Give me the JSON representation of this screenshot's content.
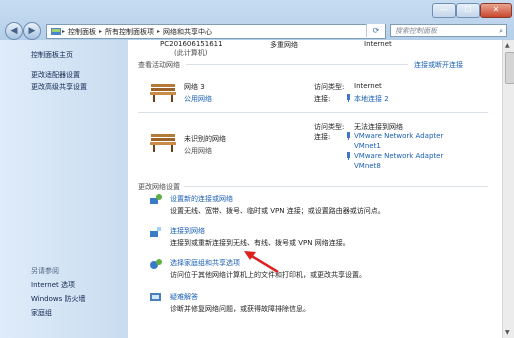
{
  "window": {
    "buttons": {
      "minimize": "—",
      "maximize": "☐",
      "close": "✕"
    }
  },
  "nav": {
    "back": "◀",
    "forward": "▶"
  },
  "breadcrumb": {
    "items": [
      "控制面板",
      "所有控制面板项",
      "网络和共享中心"
    ]
  },
  "search": {
    "placeholder": "搜索控制面板"
  },
  "sidebar": {
    "top_links": [
      "控制面板主页",
      "更改适配器设置",
      "更改高级共享设置"
    ],
    "see_also_title": "另请参阅",
    "see_also": [
      "Internet 选项",
      "Windows 防火墙",
      "家庭组"
    ]
  },
  "top_map": {
    "computer": "PC201606151611",
    "computer_note": "(此计算机)",
    "multi": "多重网络",
    "internet": "Internet"
  },
  "active": {
    "title": "查看活动网络",
    "connect_link": "连接或断开连接",
    "networks": [
      {
        "name": "网络 3",
        "type": "公用网络",
        "access_label": "访问类型:",
        "access_value": "Internet",
        "conn_label": "连接:",
        "conn_values": [
          "本地连接 2"
        ]
      },
      {
        "name": "未识别的网络",
        "type": "公用网络",
        "access_label": "访问类型:",
        "access_value": "无法连接到网络",
        "conn_label": "连接:",
        "conn_values": [
          "VMware Network Adapter",
          "VMnet1",
          "VMware Network Adapter",
          "VMnet8"
        ]
      }
    ]
  },
  "settings": {
    "title": "更改网络设置",
    "items": [
      {
        "link": "设置新的连接或网络",
        "desc": "设置无线、宽带、拨号、临时或 VPN 连接；或设置路由器或访问点。"
      },
      {
        "link": "连接到网络",
        "desc": "连接到或重新连接到无线、有线、拨号或 VPN 网络连接。"
      },
      {
        "link": "选择家庭组和共享选项",
        "desc": "访问位于其他网络计算机上的文件和打印机，或更改共享设置。"
      },
      {
        "link": "疑难解答",
        "desc": "诊断并修复网络问题，或获得故障排除信息。"
      }
    ]
  },
  "colors": {
    "link": "#1a5fb4",
    "sidebar": "#d6e6f6",
    "annotation_arrow": "#e02020"
  }
}
